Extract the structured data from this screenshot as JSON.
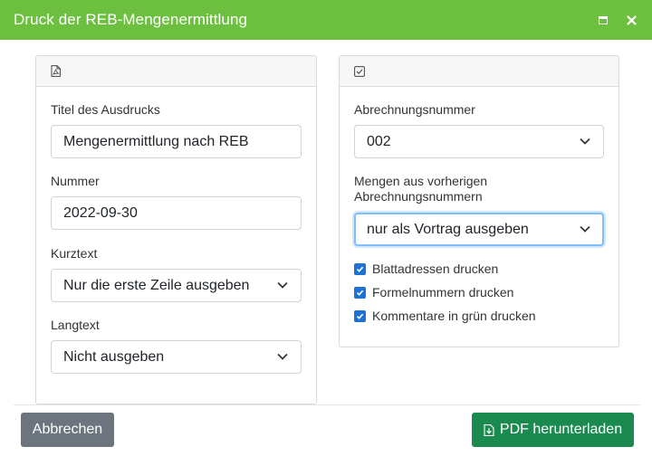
{
  "dialog": {
    "title": "Druck der REB-Mengenermittlung",
    "colors": {
      "titlebar": "#6cbf3f",
      "cancel": "#6c757d",
      "primary": "#1b8a4f",
      "checkbox": "#1d72d8"
    }
  },
  "left_panel": {
    "header_icon": "pdf-file-icon",
    "titel_label": "Titel des Ausdrucks",
    "titel_value": "Mengenermittlung nach REB",
    "nummer_label": "Nummer",
    "nummer_value": "2022-09-30",
    "kurztext_label": "Kurztext",
    "kurztext_value": "Nur die erste Zeile ausgeben",
    "langtext_label": "Langtext",
    "langtext_value": "Nicht ausgeben"
  },
  "right_panel": {
    "header_icon": "check-square-icon",
    "abrechnung_label": "Abrechnungsnummer",
    "abrechnung_value": "002",
    "mengen_label_line1": "Mengen aus vorherigen",
    "mengen_label_line2": "Abrechnungsnummern",
    "mengen_value": "nur als Vortrag ausgeben",
    "checkboxes": [
      {
        "label": "Blattadressen drucken",
        "checked": true
      },
      {
        "label": "Formelnummern drucken",
        "checked": true
      },
      {
        "label": "Kommentare in grün drucken",
        "checked": true
      }
    ]
  },
  "footer": {
    "cancel_label": "Abbrechen",
    "download_label": "PDF herunterladen"
  }
}
